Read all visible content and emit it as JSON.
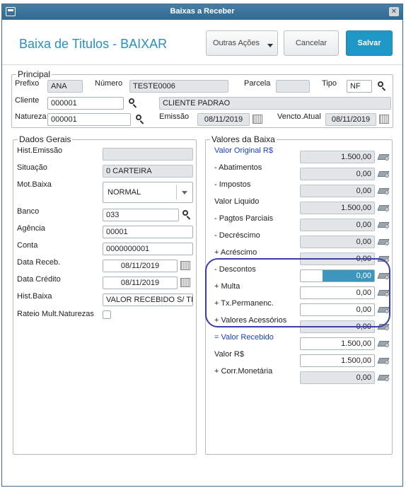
{
  "window": {
    "title": "Baixas a Receber"
  },
  "header": {
    "page_title": "Baixa de Titulos - BAIXAR",
    "outras_label": "Outras Ações",
    "cancelar_label": "Cancelar",
    "salvar_label": "Salvar"
  },
  "principal": {
    "title": "Principal",
    "prefixo_label": "Prefixo",
    "prefixo": "ANA",
    "numero_label": "Número",
    "numero": "TESTE0006",
    "parcela_label": "Parcela",
    "parcela": "",
    "tipo_label": "Tipo",
    "tipo": "NF",
    "cliente_label": "Cliente",
    "cliente": "000001",
    "cliente_nome": "CLIENTE PADRAO",
    "natureza_label": "Natureza",
    "natureza": "000001",
    "emissao_label": "Emissão",
    "emissao": "08/11/2019",
    "vencto_label": "Vencto.Atual",
    "vencto": "08/11/2019"
  },
  "dados_gerais": {
    "title": "Dados Gerais",
    "hist_emissao_label": "Hist.Emissão",
    "hist_emissao": "",
    "situacao_label": "Situação",
    "situacao": "0 CARTEIRA",
    "mot_baixa_label": "Mot.Baixa",
    "mot_baixa": "NORMAL",
    "banco_label": "Banco",
    "banco": "033",
    "agencia_label": "Agência",
    "agencia": "00001",
    "conta_label": "Conta",
    "conta": "0000000001",
    "data_receb_label": "Data Receb.",
    "data_receb": "08/11/2019",
    "data_credito_label": "Data Crédito",
    "data_credito": "08/11/2019",
    "hist_baixa_label": "Hist.Baixa",
    "hist_baixa": "VALOR RECEBIDO S/ TIT",
    "rateio_label": "Rateio Mult.Naturezas"
  },
  "valores": {
    "title": "Valores da Baixa",
    "rows": [
      {
        "label": "Valor Original R$",
        "value": "1.500,00"
      },
      {
        "label": "- Abatimentos",
        "value": "0,00"
      },
      {
        "label": "- Impostos",
        "value": "0,00"
      },
      {
        "label": "Valor Liquido",
        "value": "1.500,00"
      },
      {
        "label": "- Pagtos Parciais",
        "value": "0,00"
      },
      {
        "label": "- Decréscimo",
        "value": "0,00"
      },
      {
        "label": "+ Acréscimo",
        "value": "0,00"
      },
      {
        "label": "- Descontos",
        "value": "0,00"
      },
      {
        "label": "+ Multa",
        "value": "0,00"
      },
      {
        "label": "+ Tx.Permanenc.",
        "value": "0,00"
      },
      {
        "label": "+ Valores Acessórios",
        "value": "0,00"
      },
      {
        "label": "= Valor Recebido",
        "value": "1.500,00"
      },
      {
        "label": "Valor R$",
        "value": "1.500,00"
      },
      {
        "label": "+ Corr.Monetária",
        "value": "0,00"
      }
    ]
  },
  "colors": {
    "accent": "#2c8ec0",
    "save_button": "#1f97c7",
    "annotation": "#3a3fa8",
    "link_label": "#1a3fc4"
  }
}
